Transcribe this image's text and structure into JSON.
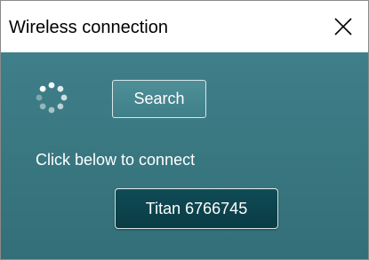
{
  "window": {
    "title": "Wireless connection",
    "close_icon": "close-icon"
  },
  "search": {
    "button_label": "Search",
    "spinner_icon": "loading-spinner-icon"
  },
  "hint": {
    "text": "Click below to connect"
  },
  "devices": [
    {
      "label": "Titan 6766745"
    }
  ],
  "colors": {
    "body_background": "#3a7a84",
    "device_button": "#0d4550",
    "text_on_dark": "#ffffff"
  }
}
